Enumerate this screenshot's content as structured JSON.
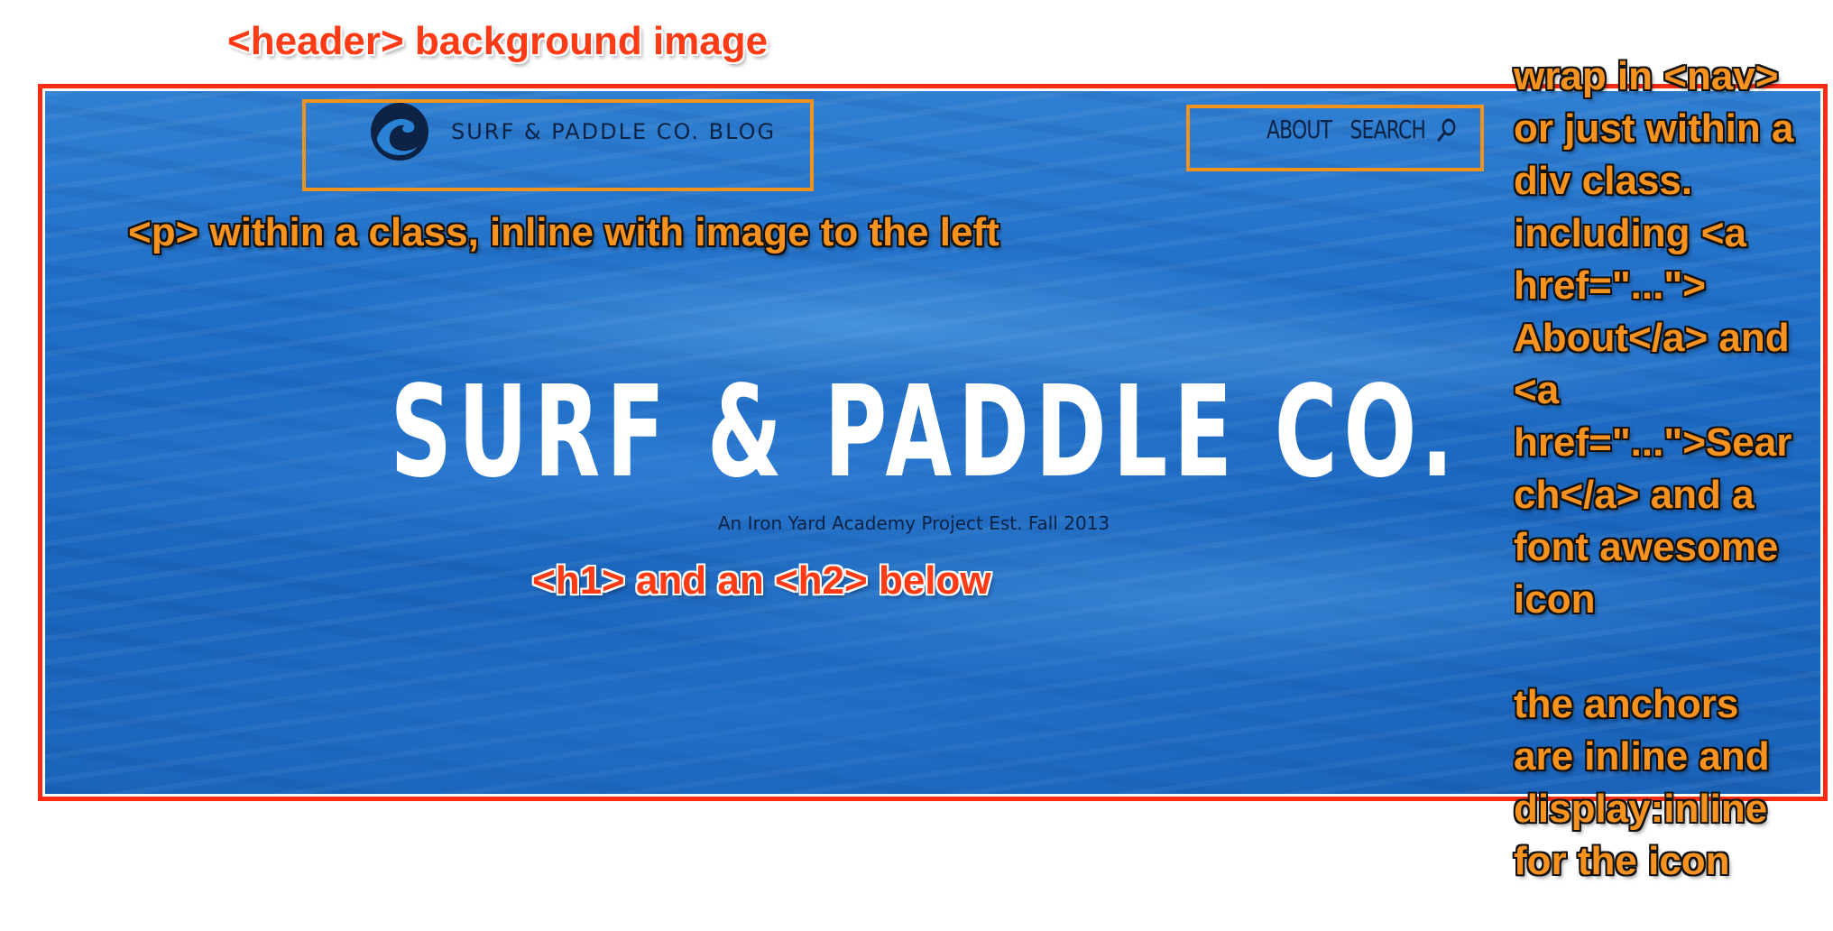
{
  "header": {
    "brand_text": "SURF & PADDLE CO. BLOG",
    "nav": {
      "about_label": "ABOUT",
      "search_label": "SEARCH"
    },
    "title": "SURF & PADDLE CO.",
    "subtitle": "An Iron Yard Academy Project Est. Fall 2013"
  },
  "annotations": {
    "header_note": "<header> background image",
    "p_note": "<p> within a class, inline with image to the left",
    "h_note": "<h1> and an <h2> below",
    "nav_note_lines": [
      "wrap in <nav>",
      "or just within a",
      "div class.",
      "including <a",
      "href=\"...\">",
      "About</a> and",
      "<a",
      "href=\"...\">Sear",
      "ch</a> and a",
      "font awesome",
      "icon"
    ],
    "anchors_note_lines": [
      "the anchors",
      "are inline and",
      "display:inline",
      "for the icon"
    ]
  },
  "colors": {
    "annotation_red": "#ff3a14",
    "annotation_orange": "#f7921e",
    "hero_blue": "#1f6fc8",
    "nav_text": "#0d2345"
  },
  "icons": {
    "logo": "wave-logo-icon",
    "search": "search-icon"
  }
}
